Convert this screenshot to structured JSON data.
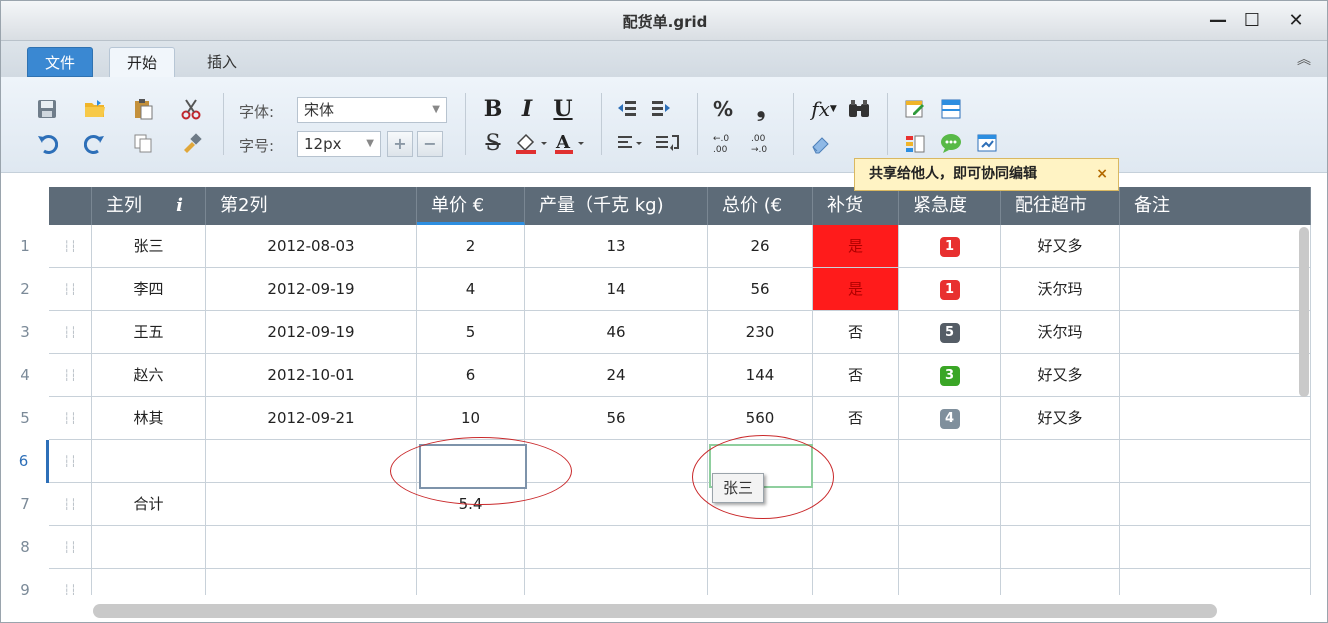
{
  "window": {
    "title": "配货单.grid",
    "minimize": "—",
    "maximize": "☐",
    "close": "✕"
  },
  "tabs": [
    {
      "label": "文件"
    },
    {
      "label": "开始"
    },
    {
      "label": "插入"
    }
  ],
  "ribbon": {
    "font_label": "字体:",
    "font_value": "宋体",
    "size_label": "字号:",
    "size_value": "12px",
    "plus": "+",
    "minus": "−",
    "bold": "B",
    "italic": "I",
    "underline": "U",
    "strike": "S",
    "percent": "%",
    "comma": "❟",
    "fx": "fx",
    "dec_inc": "+.0\n.00",
    "dec_dec": ".00\n→.0"
  },
  "tooltip": {
    "text": "共享给他人，即可协同编辑",
    "close": "×"
  },
  "grid": {
    "headers": [
      "主列",
      "第2列",
      "单价 €",
      "产量（千克 kg)",
      "总价 (€",
      "补货",
      "紧急度",
      "配往超市",
      "备注"
    ],
    "header_info_icon": "i",
    "rows": [
      {
        "num": "1",
        "name": "张三",
        "date": "2012-08-03",
        "price": "2",
        "qty": "13",
        "total": "26",
        "restock": "是",
        "urgency": "1",
        "market": "好又多",
        "note": ""
      },
      {
        "num": "2",
        "name": "李四",
        "date": "2012-09-19",
        "price": "4",
        "qty": "14",
        "total": "56",
        "restock": "是",
        "urgency": "1",
        "market": "沃尔玛",
        "note": ""
      },
      {
        "num": "3",
        "name": "王五",
        "date": "2012-09-19",
        "price": "5",
        "qty": "46",
        "total": "230",
        "restock": "否",
        "urgency": "5",
        "market": "沃尔玛",
        "note": ""
      },
      {
        "num": "4",
        "name": "赵六",
        "date": "2012-10-01",
        "price": "6",
        "qty": "24",
        "total": "144",
        "restock": "否",
        "urgency": "3",
        "market": "好又多",
        "note": ""
      },
      {
        "num": "5",
        "name": "林其",
        "date": "2012-09-21",
        "price": "10",
        "qty": "56",
        "total": "560",
        "restock": "否",
        "urgency": "4",
        "market": "好又多",
        "note": ""
      },
      {
        "num": "6",
        "name": "",
        "date": "",
        "price": "",
        "qty": "",
        "total": "",
        "restock": "",
        "urgency": "",
        "market": "",
        "note": ""
      },
      {
        "num": "7",
        "name": "合计",
        "date": "",
        "price": "5.4",
        "qty": "",
        "total": "",
        "restock": "",
        "urgency": "",
        "market": "",
        "note": ""
      },
      {
        "num": "8",
        "name": "",
        "date": "",
        "price": "",
        "qty": "",
        "total": "",
        "restock": "",
        "urgency": "",
        "market": "",
        "note": ""
      },
      {
        "num": "9",
        "name": "",
        "date": "",
        "price": "",
        "qty": "",
        "total": "",
        "restock": "",
        "urgency": "",
        "market": "",
        "note": ""
      }
    ],
    "autocomplete": "张三"
  },
  "colors": {
    "header_bg": "#5d6b78",
    "restock_yes": "#ff1b1b",
    "urgency_1": "#e8302f",
    "urgency_3": "#3aa626",
    "urgency_4": "#7f8f9c",
    "urgency_5": "#555d66"
  }
}
